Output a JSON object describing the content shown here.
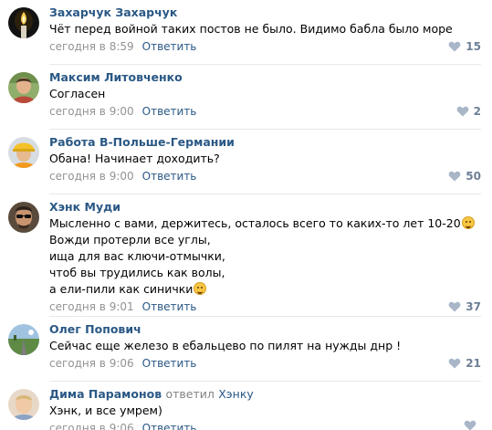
{
  "comments": [
    {
      "author": "Захарчук Захарчук",
      "lines": [
        "Чёт перед войной таких постов не было. Видимо бабла было море"
      ],
      "time": "сегодня в 8:59",
      "reply": "Ответить",
      "likes": "15",
      "avatar": "candle-avatar"
    },
    {
      "author": "Максим Литовченко",
      "lines": [
        "Согласен"
      ],
      "time": "сегодня в 9:00",
      "reply": "Ответить",
      "likes": "2",
      "avatar": "man-avatar"
    },
    {
      "author": "Работа В-Польше-Германии",
      "lines": [
        "Обана! Начинает доходить?"
      ],
      "time": "сегодня в 9:00",
      "reply": "Ответить",
      "likes": "50",
      "avatar": "worker-helmet-avatar"
    },
    {
      "author": "Хэнк Муди",
      "lines": [
        "Мысленно с вами, держитесь, осталось всего то каких-то лет 10-20",
        "Вожди протерли все углы,",
        "ища для вас ключи-отмычки,",
        "чтоб вы трудились как волы,",
        "а ели-пили как синички"
      ],
      "time": "сегодня в 9:01",
      "reply": "Ответить",
      "likes": "37",
      "avatar": "sunglasses-man-avatar"
    },
    {
      "author": "Олег Попович",
      "lines": [
        "Сейчас еще железо в ебальцево по пилят на нужды днр !"
      ],
      "time": "сегодня в 9:06",
      "reply": "Ответить",
      "likes": "21",
      "avatar": "road-avatar"
    },
    {
      "author": "Дима Парамонов",
      "reply_to_label": "ответил",
      "reply_to_name": "Хэнку",
      "lines": [
        "Хэнк, и все умрем)"
      ],
      "time": "сегодня в 9:06",
      "reply": "Ответить",
      "likes": "",
      "avatar": "child-avatar"
    }
  ],
  "colors": {
    "link": "#2a5885",
    "meta": "#939393",
    "likes": "#6e7f96",
    "separator": "#e7e8ec"
  }
}
